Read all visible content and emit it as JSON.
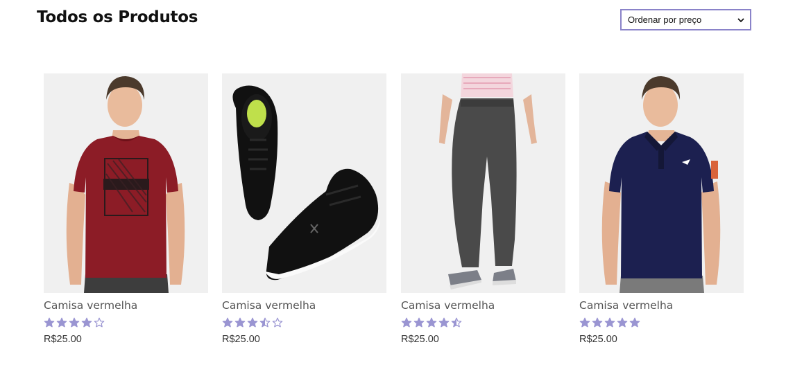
{
  "header": {
    "title": "Todos os Produtos",
    "sort_select": {
      "selected": "Ordenar por preço",
      "icon": "chevron-down-icon"
    }
  },
  "products": [
    {
      "name": "Camisa vermelha",
      "rating": 4,
      "price": "R$25.00",
      "image": "red-tshirt-photo",
      "colors": {
        "primary": "#8c1c26"
      }
    },
    {
      "name": "Camisa vermelha",
      "rating": 3.5,
      "price": "R$25.00",
      "image": "black-sneakers-photo",
      "colors": {
        "primary": "#111111"
      }
    },
    {
      "name": "Camisa vermelha",
      "rating": 4.5,
      "price": "R$25.00",
      "image": "grey-pants-photo",
      "colors": {
        "primary": "#4a4a4a"
      }
    },
    {
      "name": "Camisa vermelha",
      "rating": 5,
      "price": "R$25.00",
      "image": "navy-polo-photo",
      "colors": {
        "primary": "#1c2050"
      }
    }
  ],
  "colors": {
    "star": "#9a95d2",
    "select_border": "#8a83c9",
    "image_bg": "#f0f0f0",
    "text_muted": "#555555"
  }
}
